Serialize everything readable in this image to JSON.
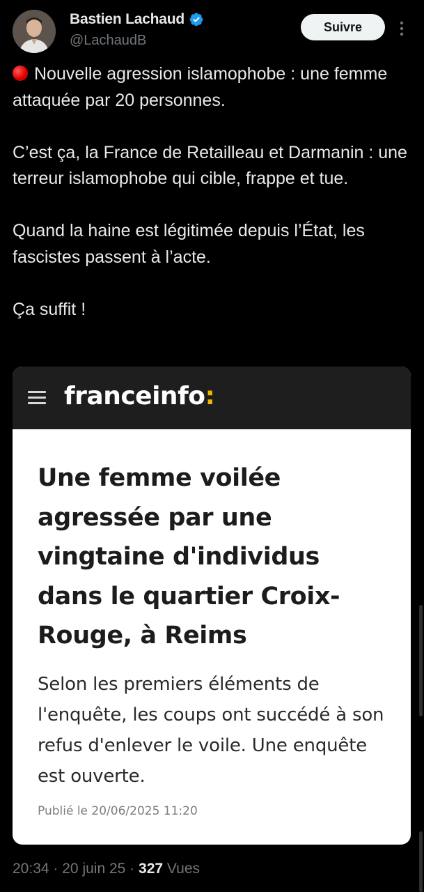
{
  "tweet": {
    "author": {
      "display_name": "Bastien Lachaud",
      "handle": "@LachaudB",
      "verified": true,
      "avatar_icon": "person-avatar"
    },
    "follow_label": "Suivre",
    "more_icon": "more-vertical-icon",
    "text": {
      "line1": "Nouvelle agression islamophobe : une femme attaquée par 20 personnes.",
      "line2": "C’est ça, la France de Retailleau et Darmanin : une terreur islamophobe qui cible, frappe et tue.",
      "line3": "Quand la haine est légitimée depuis l’État, les fascistes passent à l’acte.",
      "line4": "Ça suffit !"
    },
    "emoji": "red-circle"
  },
  "card": {
    "brand_name": "franceinfo",
    "brand_colon": ":",
    "headline": "Une femme voilée agressée par une vingtaine d'individus dans le quartier Croix-Rouge, à Reims",
    "lede": "Selon les premiers éléments de l'enquête, les coups ont succédé à son refus d'enlever le voile. Une enquête est ouverte.",
    "published": "Publié le 20/06/2025 11:20"
  },
  "meta": {
    "time": "20:34",
    "separator": "·",
    "date": "20 juin 25",
    "views_count": "327",
    "views_label": "Vues"
  },
  "colors": {
    "background": "#000000",
    "text": "#e7e9ea",
    "muted": "#71767b",
    "verified_blue": "#1d9bf0",
    "brand_accent": "#f4b400"
  }
}
